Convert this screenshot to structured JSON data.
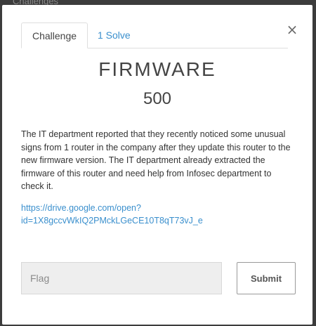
{
  "backdrop": {
    "text": "Challenges"
  },
  "tabs": [
    {
      "label": "Challenge"
    },
    {
      "label": "1 Solve"
    }
  ],
  "close_symbol": "×",
  "challenge": {
    "name": "FIRMWARE",
    "points": "500",
    "description": "The IT department reported that they recently noticed some unusual signs from 1 router in the company after they update this router to the new firmware version. The IT department already extracted the firmware of this router and need help from Infosec department to check it.",
    "link_line1": "https://drive.google.com/open?",
    "link_line2": "id=1X8gccvWkIQ2PMckLGeCE10T8qT73vJ_e"
  },
  "form": {
    "flag_placeholder": "Flag",
    "submit_label": "Submit"
  },
  "colors": {
    "accent": "#3a8fcd",
    "text": "#444444",
    "backdrop": "#3c3c3c"
  }
}
